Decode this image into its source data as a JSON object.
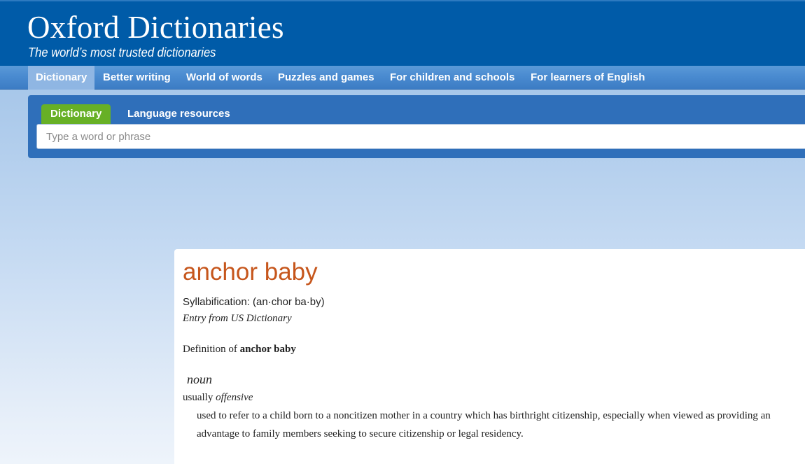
{
  "header": {
    "brand": "Oxford Dictionaries",
    "tagline": "The world’s most trusted dictionaries"
  },
  "main_nav": {
    "items": [
      {
        "label": "Dictionary",
        "active": true
      },
      {
        "label": "Better writing",
        "active": false
      },
      {
        "label": "World of words",
        "active": false
      },
      {
        "label": "Puzzles and games",
        "active": false
      },
      {
        "label": "For children and schools",
        "active": false
      },
      {
        "label": "For learners of English",
        "active": false
      }
    ]
  },
  "search": {
    "tabs": [
      {
        "label": "Dictionary",
        "active": true
      },
      {
        "label": "Language resources",
        "active": false
      }
    ],
    "placeholder": "Type a word or phrase",
    "value": ""
  },
  "entry": {
    "headword": "anchor baby",
    "syllabification": "Syllabification: (an·chor ba·by)",
    "source": "Entry from US Dictionary",
    "definition_prefix": "Definition of ",
    "definition_term": "anchor baby",
    "part_of_speech": "noun",
    "register_prefix": "usually ",
    "register_label": "offensive",
    "sense": "used to refer to a child born to a noncitizen mother in a country which has birthright citizenship, especially when viewed as providing an advantage to family members seeking to secure citizenship or legal residency."
  },
  "colors": {
    "banner": "#005ba8",
    "nav": "#4a8bd0",
    "nav_active": "#8fb6e3",
    "search_panel": "#2f6fba",
    "search_tab_active": "#67b026",
    "headword": "#c6561c"
  }
}
